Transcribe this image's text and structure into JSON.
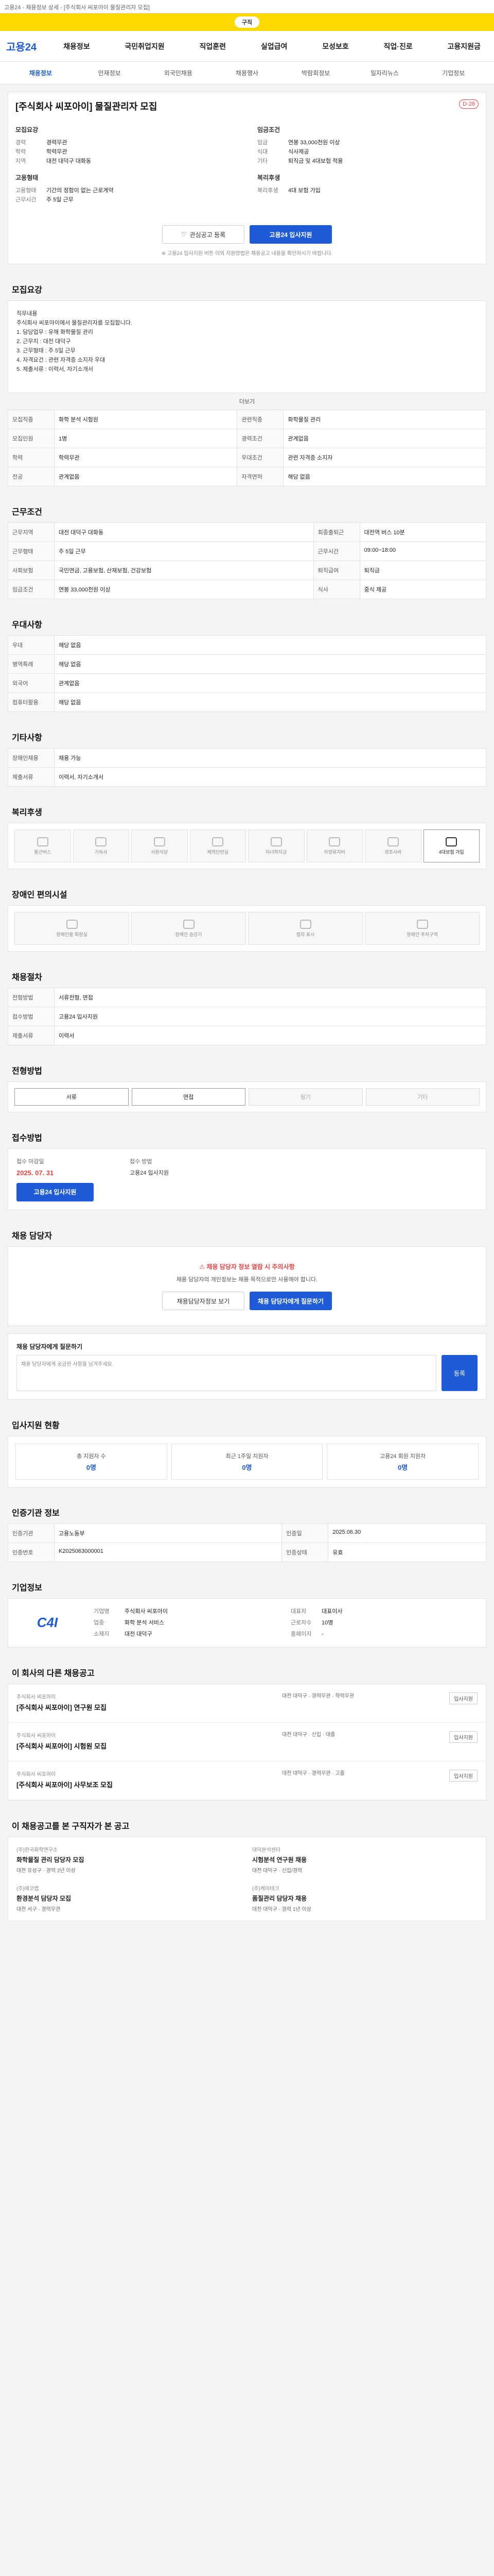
{
  "banner": "고용24 - 채용정보 상세 - [주식회사 씨포아이 물질관리자 모집]",
  "topbar": {
    "pill": "구직"
  },
  "logo": {
    "main": "고용",
    "num": "24"
  },
  "gnb": [
    "채용정보",
    "국민취업지원",
    "직업훈련",
    "실업급여",
    "모성보호",
    "직업·진로",
    "고용지원금"
  ],
  "subnav": [
    "채용정보",
    "인재정보",
    "외국인채용",
    "채용행사",
    "박람회정보",
    "일자리뉴스",
    "기업정보"
  ],
  "job": {
    "title": "[주식회사 씨포아이] 물질관리자 모집",
    "dday": "D-28",
    "left": {
      "h1": "모집요강",
      "rows": [
        [
          "경력",
          "경력무관"
        ],
        [
          "학력",
          "학력무관"
        ],
        [
          "지역",
          "대전 대덕구 대화동"
        ]
      ],
      "h2": "고용형태",
      "rows2": [
        [
          "고용형태",
          "기간의 정함이 없는 근로계약"
        ],
        [
          "근무시간",
          "주 5일 근무"
        ]
      ]
    },
    "right": {
      "h1": "임금조건",
      "rows": [
        [
          "임금",
          "연봉 33,000천원 이상"
        ],
        [
          "식대",
          "식사제공"
        ],
        [
          "기타",
          "퇴직금 및 4대보험 적용"
        ]
      ],
      "h2": "복리후생",
      "rows2": [
        [
          "복리후생",
          "4대 보험 가입"
        ]
      ]
    },
    "btn_interest": "관심공고 등록",
    "btn_apply": "고용24 입사지원",
    "note": "※ 고용24 입사지원 버튼 이외 지원방법은 채용공고 내용을 확인하시기 바랍니다."
  },
  "sections": {
    "recruit": "모집요강",
    "work": "근무조건",
    "welfare": "우대사항",
    "etc": "기타사항",
    "benefit": "복리후생",
    "disability": "장애인 편의시설",
    "process": "채용절차",
    "method": "전형방법",
    "apply": "접수방법",
    "contact": "채용 담당자",
    "qna": "채용 담당자에게 질문하기",
    "stats": "입사지원 현황",
    "manager": "인증기관 정보",
    "company": "기업정보",
    "related": "이 회사의 다른 채용공고",
    "recommend": "이 채용공고를 본 구직자가 본 공고"
  },
  "desc": {
    "lines": [
      "직무내용",
      "주식회사 씨포아이에서 물질관리자를 모집합니다.",
      "1. 담당업무 : 유해 화학물질 관리",
      "2. 근무지 : 대전 대덕구",
      "3. 근무형태 : 주 5일 근무",
      "4. 자격요건 : 관련 자격증 소지자 우대",
      "5. 제출서류 : 이력서, 자기소개서"
    ],
    "more": "더보기"
  },
  "recruit_table": [
    [
      "모집직종",
      "화학 분석 시험원",
      "관련직종",
      "화학물질 관리"
    ],
    [
      "모집인원",
      "1명",
      "경력조건",
      "관계없음"
    ],
    [
      "학력",
      "학력무관",
      "우대조건",
      "관련 자격증 소지자"
    ],
    [
      "전공",
      "관계없음",
      "자격면허",
      "해당 없음"
    ]
  ],
  "work_table": [
    [
      "근무지역",
      "대전 대덕구 대화동",
      "최종출퇴근",
      "대전역 버스 10분"
    ],
    [
      "근무형태",
      "주 5일 근무",
      "근무시간",
      "09:00~18:00"
    ],
    [
      "사회보험",
      "국민연금, 고용보험, 산재보험, 건강보험",
      "퇴직급여",
      "퇴직금"
    ],
    [
      "임금조건",
      "연봉 33,000천원 이상",
      "식사",
      "중식 제공"
    ]
  ],
  "welfare_table": [
    [
      "우대",
      "해당 없음"
    ],
    [
      "병역특례",
      "해당 없음"
    ],
    [
      "외국어",
      "관계없음"
    ],
    [
      "컴퓨터활용",
      "해당 없음"
    ]
  ],
  "etc_table": [
    [
      "장애인채용",
      "채용 가능"
    ],
    [
      "제출서류",
      "이력서, 자기소개서"
    ]
  ],
  "benefits": [
    "통근버스",
    "기숙사",
    "사원식당",
    "체력단련실",
    "자녀학자금",
    "차량유지비",
    "경조사비",
    "4대보험 가입"
  ],
  "benefit_on": [
    7
  ],
  "disability": [
    "장애인용 화장실",
    "장애인 승강기",
    "점자 표시",
    "장애인 주차구역"
  ],
  "process_table": [
    [
      "전형방법",
      "서류전형, 면접"
    ],
    [
      "접수방법",
      "고용24 입사지원"
    ],
    [
      "제출서류",
      "이력서"
    ]
  ],
  "method": [
    "서류",
    "면접",
    "필기",
    "기타"
  ],
  "method_on": [
    0,
    1
  ],
  "apply": {
    "l1": "접수 마감일",
    "date": "2025. 07. 31",
    "l2": "접수 방법",
    "v2": "고용24 입사지원",
    "btn": "고용24 입사지원"
  },
  "contact": {
    "warn": "채용 담당자 정보 열람 시 주의사항",
    "text": "채용 담당자의 개인정보는 채용 목적으로만 사용해야 합니다.",
    "b1": "채용담당자정보 보기",
    "b2": "채용 담당자에게 질문하기"
  },
  "qna": {
    "placeholder": "채용 담당자에게 궁금한 사항을 남겨주세요.",
    "send": "등록"
  },
  "stats": [
    [
      "총 지원자 수",
      "0명"
    ],
    [
      "최근 1주일 지원자",
      "0명"
    ],
    [
      "고용24 회원 지원자",
      "0명"
    ]
  ],
  "manager_table": [
    [
      "인증기관",
      "고용노동부",
      "인증일",
      "2025.06.30"
    ],
    [
      "인증번호",
      "K2025063000001",
      "인증상태",
      "유효"
    ]
  ],
  "company": {
    "logo": "C4I",
    "rows": [
      [
        "기업명",
        "주식회사 씨포아이"
      ],
      [
        "대표자",
        "대표이사"
      ],
      [
        "업종",
        "화학 분석 서비스"
      ],
      [
        "근로자수",
        "10명"
      ],
      [
        "소재지",
        "대전 대덕구"
      ],
      [
        "홈페이지",
        "-"
      ]
    ]
  },
  "related": [
    {
      "co": "주식회사 씨포아이",
      "t": "[주식회사 씨포아이] 연구원 모집",
      "m": "대전 대덕구 · 경력무관 · 학력무관",
      "b": "입사지원"
    },
    {
      "co": "주식회사 씨포아이",
      "t": "[주식회사 씨포아이] 시험원 모집",
      "m": "대전 대덕구 · 신입 · 대졸",
      "b": "입사지원"
    },
    {
      "co": "주식회사 씨포아이",
      "t": "[주식회사 씨포아이] 사무보조 모집",
      "m": "대전 대덕구 · 경력무관 · 고졸",
      "b": "입사지원"
    }
  ],
  "recommend": [
    {
      "co": "(주)한국화학연구소",
      "t": "화학물질 관리 담당자 모집",
      "m": "대전 유성구 · 경력 2년 이상"
    },
    {
      "co": "대덕분석센터",
      "t": "시험분석 연구원 채용",
      "m": "대전 대덕구 · 신입/경력"
    },
    {
      "co": "(주)에코랩",
      "t": "환경분석 담당자 모집",
      "m": "대전 서구 · 경력무관"
    },
    {
      "co": "(주)케미테크",
      "t": "품질관리 담당자 채용",
      "m": "대전 대덕구 · 경력 1년 이상"
    }
  ],
  "colors": {
    "brand": "#1e5bd8",
    "accent": "#ffd800",
    "warn": "#e44444"
  }
}
